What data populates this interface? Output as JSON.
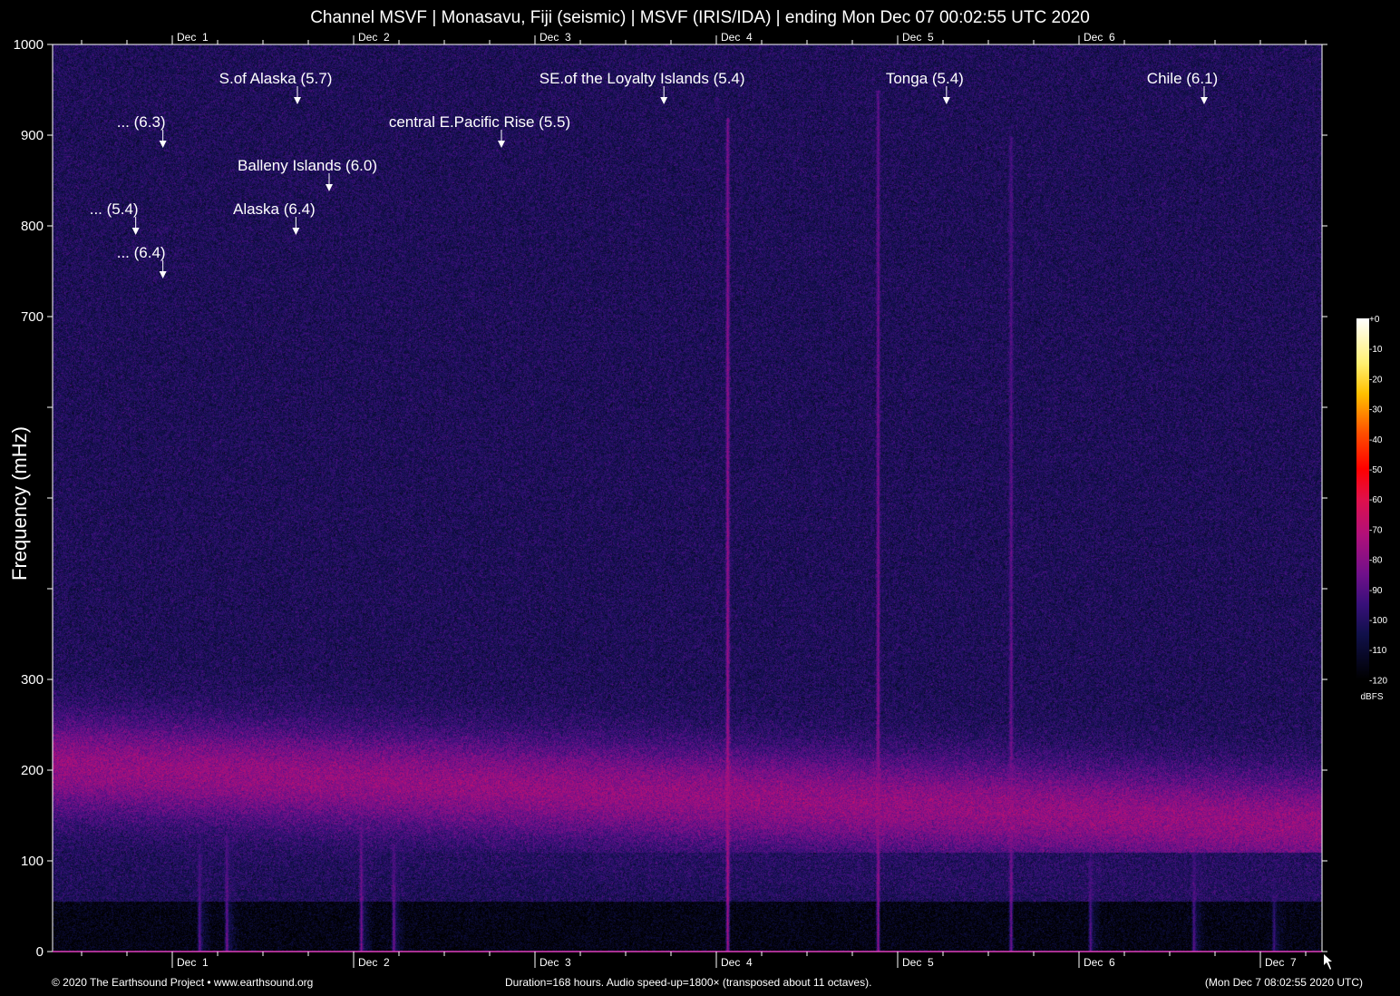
{
  "title": "Channel MSVF | Monasavu, Fiji (seismic) | MSVF (IRIS/IDA) | ending Mon Dec 07 00:02:55 UTC 2020",
  "footer": {
    "left": "© 2020 The Earthsound Project • www.earthsound.org",
    "center": "Duration=168 hours. Audio speed-up=1800× (transposed about 11 octaves).",
    "right": "(Mon Dec  7 08:02:55 2020 UTC)"
  },
  "chart_data": {
    "type": "heatmap",
    "title": "Channel MSVF | Monasavu, Fiji (seismic) | MSVF (IRIS/IDA) | ending Mon Dec 07 00:02:55 UTC 2020",
    "xlabel": "",
    "ylabel": "Frequency (mHz)",
    "x_units": "hours",
    "xlim": [
      0,
      168
    ],
    "ylim": [
      0,
      1000
    ],
    "y_ticks": [
      0,
      100,
      200,
      300,
      400,
      500,
      600,
      700,
      800,
      900,
      1000
    ],
    "y_tick_labels": [
      "0",
      "100",
      "200",
      "300",
      "",
      "",
      "",
      "700",
      "800",
      "900",
      "1000"
    ],
    "x_ticks": [
      {
        "hour": 15.84,
        "label": "Dec  1"
      },
      {
        "hour": 39.84,
        "label": "Dec  2"
      },
      {
        "hour": 63.84,
        "label": "Dec  3"
      },
      {
        "hour": 87.84,
        "label": "Dec  4"
      },
      {
        "hour": 111.84,
        "label": "Dec  5"
      },
      {
        "hour": 135.84,
        "label": "Dec  6"
      },
      {
        "hour": 159.84,
        "label": "Dec  7"
      }
    ],
    "minor_tick_hours": 6,
    "colorbar": {
      "label": "dBFS",
      "range": [
        -120,
        0
      ],
      "tick_labels": [
        "+0",
        "-10",
        "-20",
        "-30",
        "-40",
        "-50",
        "-60",
        "-70",
        "-80",
        "-90",
        "-100",
        "-110",
        "-120"
      ],
      "stops": [
        {
          "db": 0,
          "color": "#ffffff"
        },
        {
          "db": -15,
          "color": "#fff070"
        },
        {
          "db": -25,
          "color": "#ffc000"
        },
        {
          "db": -38,
          "color": "#ff5000"
        },
        {
          "db": -50,
          "color": "#ff0000"
        },
        {
          "db": -60,
          "color": "#e0104a"
        },
        {
          "db": -72,
          "color": "#b0107a"
        },
        {
          "db": -85,
          "color": "#70108a"
        },
        {
          "db": -95,
          "color": "#38107a"
        },
        {
          "db": -105,
          "color": "#10104a"
        },
        {
          "db": -120,
          "color": "#000000"
        }
      ]
    },
    "noise_band": {
      "center_mhz_start": 205,
      "center_mhz_end": 140,
      "peak_db": -78
    },
    "events": [
      {
        "label": "S.of Alaska (5.7)",
        "hour": 32.4,
        "arrow_mhz": 934
      },
      {
        "label": "SE.of the Loyalty Islands (5.4)",
        "hour": 80.9,
        "arrow_mhz": 934
      },
      {
        "label": "Tonga (5.4)",
        "hour": 118.3,
        "arrow_mhz": 934
      },
      {
        "label": "Chile (6.1)",
        "hour": 152.4,
        "arrow_mhz": 934
      },
      {
        "label": "... (6.3)",
        "hour": 14.6,
        "arrow_mhz": 886
      },
      {
        "label": "central E.Pacific Rise (5.5)",
        "hour": 59.4,
        "arrow_mhz": 886
      },
      {
        "label": "Balleny Islands (6.0)",
        "hour": 36.6,
        "arrow_mhz": 838
      },
      {
        "label": "... (5.4)",
        "hour": 11.0,
        "arrow_mhz": 790
      },
      {
        "label": "Alaska (6.4)",
        "hour": 32.2,
        "arrow_mhz": 790
      },
      {
        "label": "... (6.4)",
        "hour": 14.6,
        "arrow_mhz": 742
      }
    ],
    "signal_lines": [
      {
        "hour": 19.4,
        "max_mhz": 120,
        "db": -85
      },
      {
        "hour": 23.0,
        "max_mhz": 130,
        "db": -82
      },
      {
        "hour": 40.8,
        "max_mhz": 140,
        "db": -80
      },
      {
        "hour": 45.1,
        "max_mhz": 120,
        "db": -82
      },
      {
        "hour": 89.3,
        "max_mhz": 920,
        "db": -72
      },
      {
        "hour": 109.2,
        "max_mhz": 950,
        "db": -78
      },
      {
        "hour": 126.8,
        "max_mhz": 900,
        "db": -82
      },
      {
        "hour": 137.3,
        "max_mhz": 120,
        "db": -86
      },
      {
        "hour": 151.0,
        "max_mhz": 130,
        "db": -86
      },
      {
        "hour": 161.6,
        "max_mhz": 80,
        "db": -90
      }
    ]
  }
}
